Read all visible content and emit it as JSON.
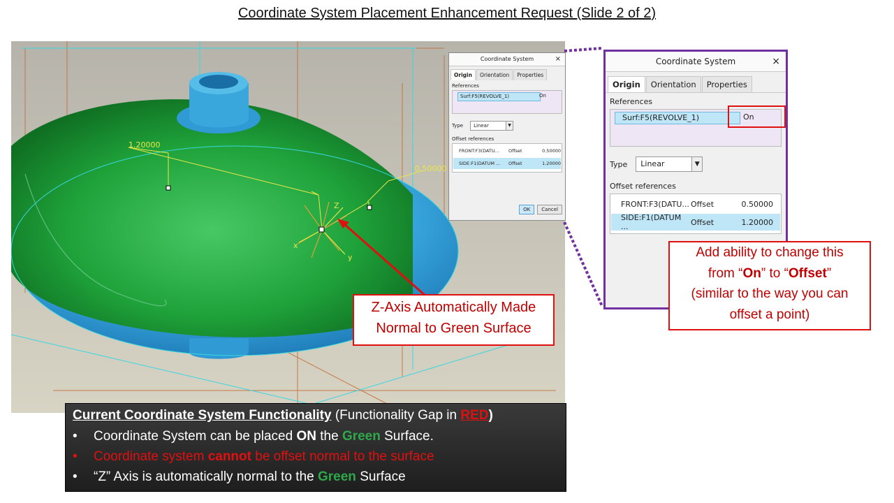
{
  "title": "Coordinate System Placement Enhancement Request (Slide 2 of 2)",
  "viewport": {
    "dim1": "1.20000",
    "dim2": "0.50000",
    "axis_x": "x",
    "axis_y": "y",
    "axis_z": "Z"
  },
  "dialog": {
    "title": "Coordinate System",
    "close": "×",
    "tabs": [
      "Origin",
      "Orientation",
      "Properties"
    ],
    "references_label": "References",
    "reference_item": "Surf:F5(REVOLVE_1)",
    "reference_constraint": "On",
    "type_label": "Type",
    "type_value": "Linear",
    "offset_label": "Offset references",
    "offset_rows": [
      {
        "ref_small": "FRONT:F3(DATU...",
        "ref_large": "FRONT:F3(DATU...",
        "kind": "Offset",
        "value": "0.50000"
      },
      {
        "ref_small": "SIDE:F1(DATUM ...",
        "ref_large": "SIDE:F1(DATUM ...",
        "kind": "Offset",
        "value": "1.20000"
      }
    ],
    "ok": "OK",
    "cancel": "Cancel"
  },
  "callout_right": {
    "line1": "Add ability to change this",
    "line2_pre": "from “",
    "line2_on": "On",
    "line2_mid": "” to “",
    "line2_offset": "Offset",
    "line2_post": "”",
    "line3": "(similar to the way you can",
    "line4": "offset a point)"
  },
  "callout_z": {
    "line1": "Z-Axis Automatically Made",
    "line2": "Normal to Green Surface"
  },
  "info": {
    "heading": "Current Coordinate System Functionality",
    "heading_paren_pre": "(Functionality Gap in ",
    "heading_red": "RED",
    "heading_paren_post": ")",
    "bullet": "•",
    "b1_pre": "Coordinate System can be placed ",
    "b1_on": "ON",
    "b1_mid": " the ",
    "b1_green": "Green",
    "b1_post": " Surface.",
    "b2_pre": "Coordinate system ",
    "b2_bold": "cannot",
    "b2_post": " be offset normal to the surface",
    "b3_pre": "“Z” Axis is automatically normal to the ",
    "b3_green": "Green",
    "b3_post": " Surface"
  },
  "colors": {
    "red": "#e01010",
    "green_surface": "#1fa23a",
    "blue_surface": "#3aa9e0",
    "purple": "#7030a0"
  }
}
